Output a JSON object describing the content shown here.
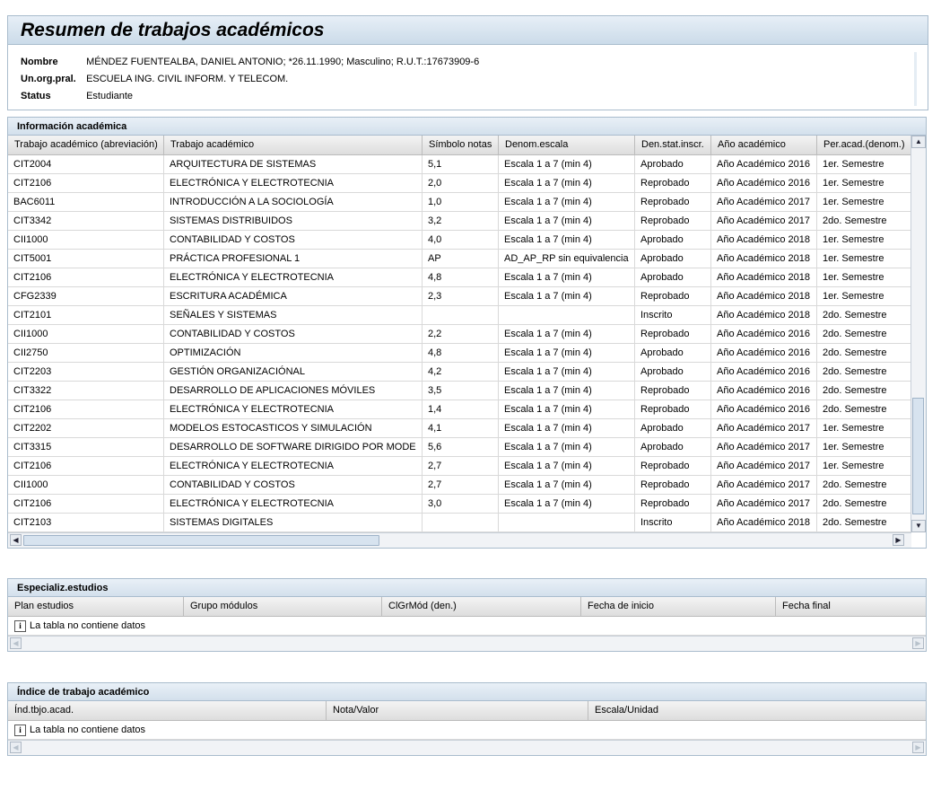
{
  "header": {
    "title": "Resumen de trabajos académicos",
    "fields": [
      {
        "label": "Nombre",
        "value": "MÉNDEZ FUENTEALBA, DANIEL ANTONIO; *26.11.1990; Masculino; R.U.T.:17673909-6"
      },
      {
        "label": "Un.org.pral.",
        "value": "ESCUELA ING. CIVIL INFORM. Y TELECOM."
      },
      {
        "label": "Status",
        "value": "Estudiante"
      }
    ]
  },
  "academic": {
    "title": "Información académica",
    "columns": [
      "Trabajo académico (abreviación)",
      "Trabajo académico",
      "Símbolo notas",
      "Denom.escala",
      "Den.stat.inscr.",
      "Año académico",
      "Per.acad.(denom.)"
    ],
    "rows": [
      [
        "CIT2004",
        "ARQUITECTURA DE SISTEMAS",
        "5,1",
        "Escala 1 a 7 (min 4)",
        "Aprobado",
        "Año Académico 2016",
        "1er. Semestre"
      ],
      [
        "CIT2106",
        "ELECTRÓNICA Y ELECTROTECNIA",
        "2,0",
        "Escala 1 a 7 (min 4)",
        "Reprobado",
        "Año Académico 2016",
        "1er. Semestre"
      ],
      [
        "BAC6011",
        "INTRODUCCIÓN A LA SOCIOLOGÍA",
        "1,0",
        "Escala 1 a 7 (min 4)",
        "Reprobado",
        "Año Académico 2017",
        "1er. Semestre"
      ],
      [
        "CIT3342",
        "SISTEMAS DISTRIBUIDOS",
        "3,2",
        "Escala 1 a 7 (min 4)",
        "Reprobado",
        "Año Académico 2017",
        "2do. Semestre"
      ],
      [
        "CII1000",
        "CONTABILIDAD Y COSTOS",
        "4,0",
        "Escala 1 a 7 (min 4)",
        "Aprobado",
        "Año Académico 2018",
        "1er. Semestre"
      ],
      [
        "CIT5001",
        "PRÁCTICA PROFESIONAL 1",
        "AP",
        "AD_AP_RP sin equivalencia",
        "Aprobado",
        "Año Académico 2018",
        "1er. Semestre"
      ],
      [
        "CIT2106",
        "ELECTRÓNICA Y ELECTROTECNIA",
        "4,8",
        "Escala 1 a 7 (min 4)",
        "Aprobado",
        "Año Académico 2018",
        "1er. Semestre"
      ],
      [
        "CFG2339",
        "ESCRITURA ACADÉMICA",
        "2,3",
        "Escala 1 a 7 (min 4)",
        "Reprobado",
        "Año Académico 2018",
        "1er. Semestre"
      ],
      [
        "CIT2101",
        "SEÑALES Y SISTEMAS",
        "",
        "",
        "Inscrito",
        "Año Académico 2018",
        "2do. Semestre"
      ],
      [
        "CII1000",
        "CONTABILIDAD Y COSTOS",
        "2,2",
        "Escala 1 a 7 (min 4)",
        "Reprobado",
        "Año Académico 2016",
        "2do. Semestre"
      ],
      [
        "CII2750",
        "OPTIMIZACIÓN",
        "4,8",
        "Escala 1 a 7 (min 4)",
        "Aprobado",
        "Año Académico 2016",
        "2do. Semestre"
      ],
      [
        "CIT2203",
        "GESTIÓN ORGANIZACIÓNAL",
        "4,2",
        "Escala 1 a 7 (min 4)",
        "Aprobado",
        "Año Académico 2016",
        "2do. Semestre"
      ],
      [
        "CIT3322",
        "DESARROLLO DE APLICACIONES MÓVILES",
        "3,5",
        "Escala 1 a 7 (min 4)",
        "Reprobado",
        "Año Académico 2016",
        "2do. Semestre"
      ],
      [
        "CIT2106",
        "ELECTRÓNICA Y ELECTROTECNIA",
        "1,4",
        "Escala 1 a 7 (min 4)",
        "Reprobado",
        "Año Académico 2016",
        "2do. Semestre"
      ],
      [
        "CIT2202",
        "MODELOS ESTOCASTICOS Y SIMULACIÓN",
        "4,1",
        "Escala 1 a 7 (min 4)",
        "Aprobado",
        "Año Académico 2017",
        "1er. Semestre"
      ],
      [
        "CIT3315",
        "DESARROLLO DE SOFTWARE DIRIGIDO POR MODE",
        "5,6",
        "Escala 1 a 7 (min 4)",
        "Aprobado",
        "Año Académico 2017",
        "1er. Semestre"
      ],
      [
        "CIT2106",
        "ELECTRÓNICA Y ELECTROTECNIA",
        "2,7",
        "Escala 1 a 7 (min 4)",
        "Reprobado",
        "Año Académico 2017",
        "1er. Semestre"
      ],
      [
        "CII1000",
        "CONTABILIDAD Y COSTOS",
        "2,7",
        "Escala 1 a 7 (min 4)",
        "Reprobado",
        "Año Académico 2017",
        "2do. Semestre"
      ],
      [
        "CIT2106",
        "ELECTRÓNICA Y ELECTROTECNIA",
        "3,0",
        "Escala 1 a 7 (min 4)",
        "Reprobado",
        "Año Académico 2017",
        "2do. Semestre"
      ],
      [
        "CIT2103",
        "SISTEMAS DIGITALES",
        "",
        "",
        "Inscrito",
        "Año Académico 2018",
        "2do. Semestre"
      ]
    ]
  },
  "specialization": {
    "title": "Especializ.estudios",
    "columns": [
      "Plan estudios",
      "Grupo módulos",
      "ClGrMód (den.)",
      "Fecha de inicio",
      "Fecha final"
    ],
    "empty_text": "La tabla no contiene datos"
  },
  "index": {
    "title": "Índice de trabajo académico",
    "columns": [
      "Índ.tbjo.acad.",
      "Nota/Valor",
      "Escala/Unidad"
    ],
    "empty_text": "La tabla no contiene datos"
  },
  "icons": {
    "info": "info-icon",
    "scroll_up": "scroll-up-icon",
    "scroll_down": "scroll-down-icon",
    "scroll_left": "scroll-left-icon",
    "scroll_right": "scroll-right-icon"
  }
}
